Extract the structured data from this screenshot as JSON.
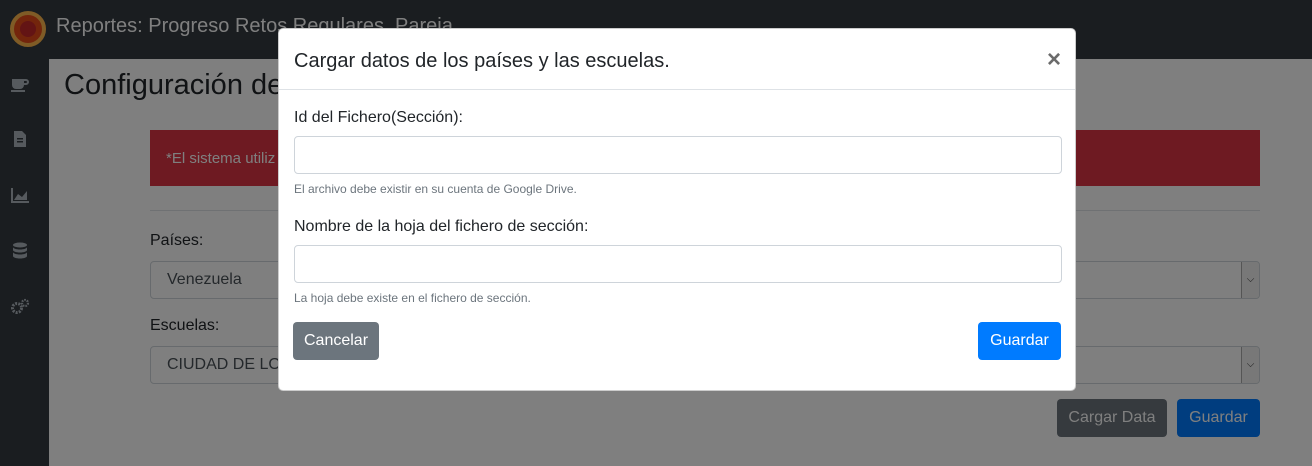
{
  "header": {
    "title": "Reportes: Progreso Retos Regulares, Pareja"
  },
  "sidebar": {
    "icons": [
      "coffee-icon",
      "document-icon",
      "area-chart-icon",
      "database-icon",
      "gears-icon"
    ]
  },
  "main": {
    "page_title": "Configuración de",
    "alert_text": "*El sistema utiliz",
    "countries": {
      "label": "Países:",
      "selected": "Venezuela"
    },
    "schools": {
      "label": "Escuelas:",
      "selected": "CIUDAD DE LOS"
    },
    "load_button": "Cargar Data",
    "save_button": "Guardar"
  },
  "modal": {
    "title": "Cargar datos de los países y las escuelas.",
    "close_label": "×",
    "file_id": {
      "label": "Id del Fichero(Sección):",
      "value": "",
      "help": "El archivo debe existir en su cuenta de Google Drive."
    },
    "sheet_name": {
      "label": "Nombre de la hoja del fichero de sección:",
      "value": "",
      "help": "La hoja debe existe en el fichero de sección."
    },
    "cancel_button": "Cancelar",
    "save_button": "Guardar"
  },
  "colors": {
    "topbar": "#343a40",
    "danger": "#dc3545",
    "primary": "#007bff",
    "secondary": "#6c757d"
  }
}
